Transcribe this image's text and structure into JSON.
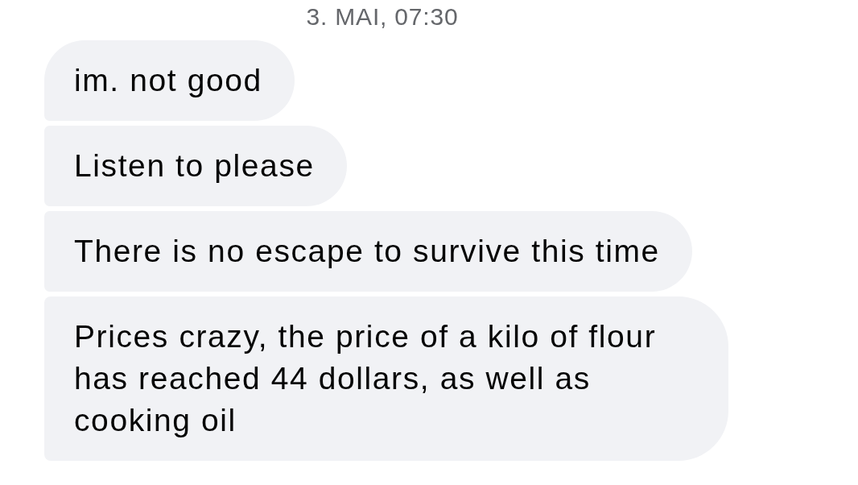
{
  "timestamp": "3. MAI, 07:30",
  "messages": [
    {
      "text": "im. not good"
    },
    {
      "text": "Listen to please"
    },
    {
      "text": "There is no escape to survive this time"
    },
    {
      "text": "Prices crazy, the price of a kilo of flour has reached 44 dollars, as well as cooking oil"
    }
  ]
}
